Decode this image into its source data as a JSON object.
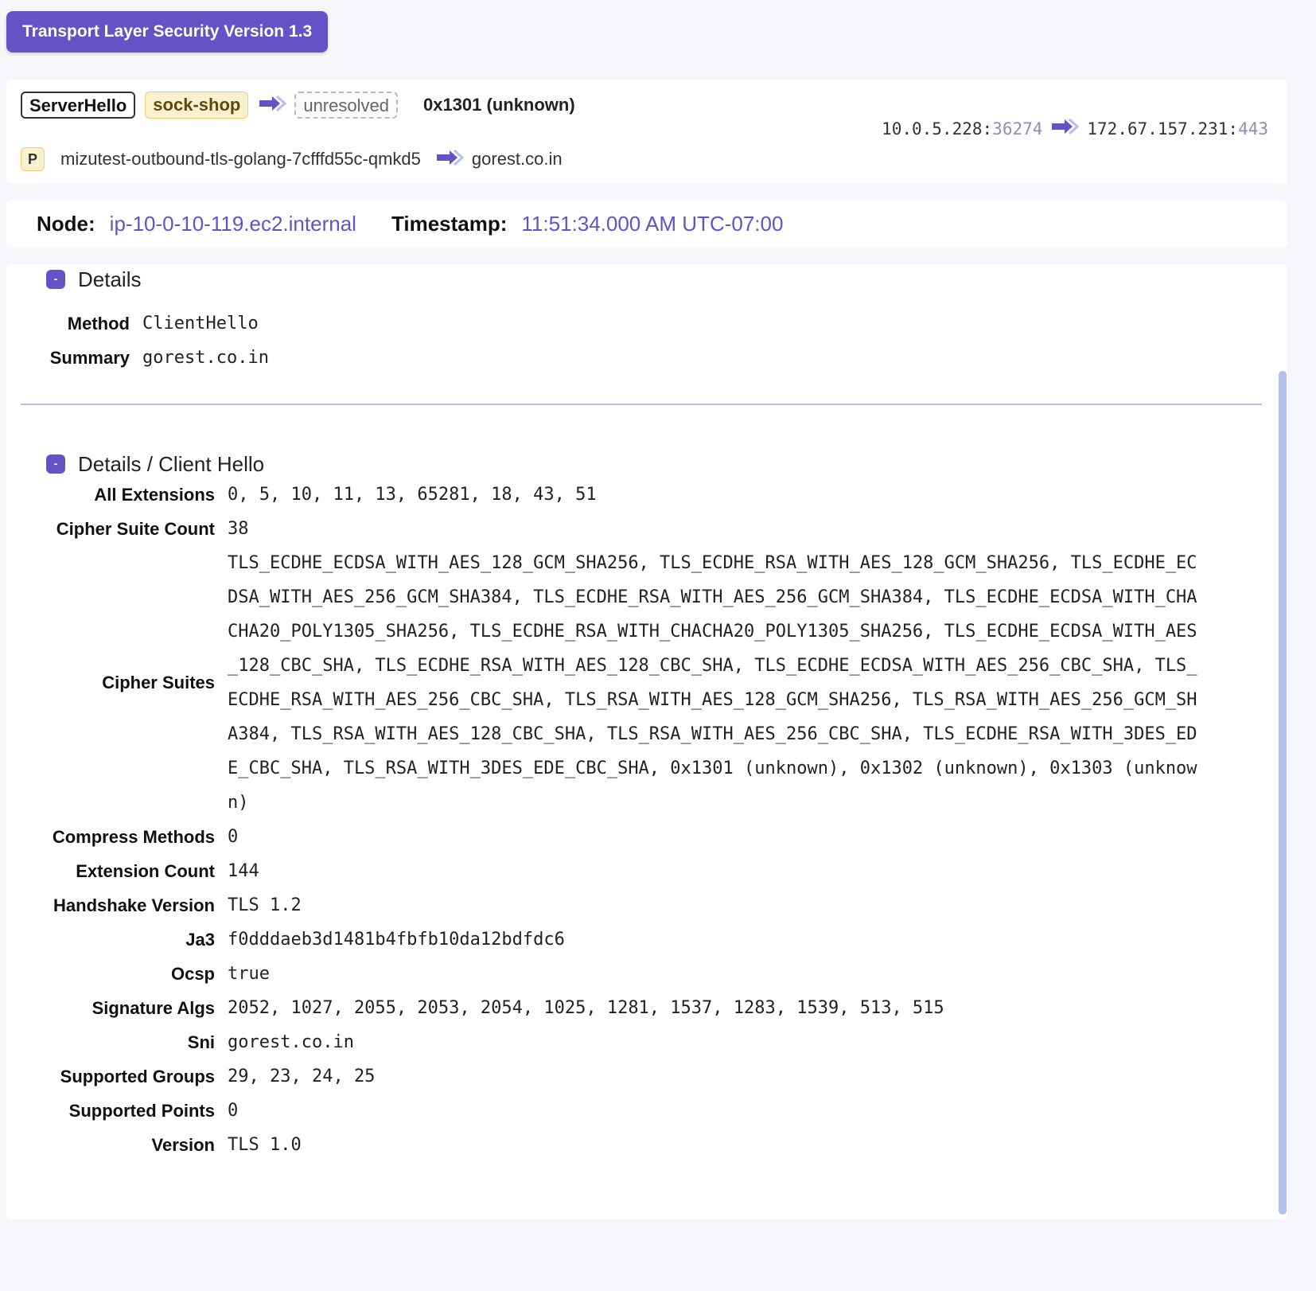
{
  "protocol_badge": "Transport Layer Security Version 1.3",
  "entry": {
    "method": "ServerHello",
    "service": "sock-shop",
    "destination": "unresolved",
    "summary": "0x1301 (unknown)",
    "protocol_abbr": "P",
    "source_name": "mizutest-outbound-tls-golang-7cfffd55c-qmkd5",
    "dest_name": "gorest.co.in",
    "src_ip": "10.0.5.228",
    "src_port": "36274",
    "dst_ip": "172.67.157.231",
    "dst_port": "443",
    "ip_sep": ":"
  },
  "info": {
    "node_label": "Node:",
    "node_value": "ip-10-0-10-119.ec2.internal",
    "timestamp_label": "Timestamp:",
    "timestamp_value": "11:51:34.000 AM UTC-07:00"
  },
  "details": {
    "title": "Details",
    "collapse_symbol": "-",
    "method_label": "Method",
    "method_value": "ClientHello",
    "summary_label": "Summary",
    "summary_value": "gorest.co.in"
  },
  "client_hello": {
    "title": "Details / Client Hello",
    "rows": [
      {
        "label": "All Extensions",
        "value": "0, 5, 10, 11, 13, 65281, 18, 43, 51"
      },
      {
        "label": "Cipher Suite Count",
        "value": "38"
      },
      {
        "label": "Cipher Suites",
        "value": "TLS_ECDHE_ECDSA_WITH_AES_128_GCM_SHA256, TLS_ECDHE_RSA_WITH_AES_128_GCM_SHA256, TLS_ECDHE_ECDSA_WITH_AES_256_GCM_SHA384, TLS_ECDHE_RSA_WITH_AES_256_GCM_SHA384, TLS_ECDHE_ECDSA_WITH_CHACHA20_POLY1305_SHA256, TLS_ECDHE_RSA_WITH_CHACHA20_POLY1305_SHA256, TLS_ECDHE_ECDSA_WITH_AES_128_CBC_SHA, TLS_ECDHE_RSA_WITH_AES_128_CBC_SHA, TLS_ECDHE_ECDSA_WITH_AES_256_CBC_SHA, TLS_ECDHE_RSA_WITH_AES_256_CBC_SHA, TLS_RSA_WITH_AES_128_GCM_SHA256, TLS_RSA_WITH_AES_256_GCM_SHA384, TLS_RSA_WITH_AES_128_CBC_SHA, TLS_RSA_WITH_AES_256_CBC_SHA, TLS_ECDHE_RSA_WITH_3DES_EDE_CBC_SHA, TLS_RSA_WITH_3DES_EDE_CBC_SHA, 0x1301 (unknown), 0x1302 (unknown), 0x1303 (unknown)"
      },
      {
        "label": "Compress Methods",
        "value": "0"
      },
      {
        "label": "Extension Count",
        "value": "144"
      },
      {
        "label": "Handshake Version",
        "value": "TLS 1.2"
      },
      {
        "label": "Ja3",
        "value": "f0dddaeb3d1481b4fbfb10da12bdfdc6"
      },
      {
        "label": "Ocsp",
        "value": "true"
      },
      {
        "label": "Signature Algs",
        "value": "2052, 1027, 2055, 2053, 2054, 1025, 1281, 1537, 1283, 1539, 513, 515"
      },
      {
        "label": "Sni",
        "value": "gorest.co.in"
      },
      {
        "label": "Supported Groups",
        "value": "29, 23, 24, 25"
      },
      {
        "label": "Supported Points",
        "value": "0"
      },
      {
        "label": "Version",
        "value": "TLS 1.0"
      }
    ]
  },
  "colors": {
    "accent": "#6552c6",
    "service_bg": "#fbf1cf",
    "divider": "#b3c1f0",
    "background": "#f6f7fb"
  },
  "icons": {
    "flow_arrow": "arrow-right-icon",
    "collapse": "collapse-icon"
  }
}
